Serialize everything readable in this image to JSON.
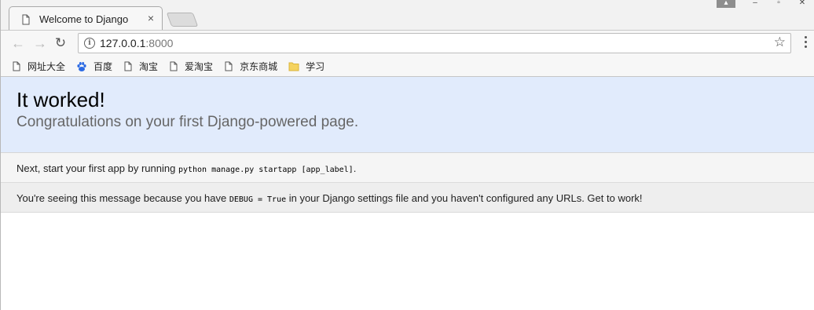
{
  "browser": {
    "tab_title": "Welcome to Django",
    "tab_close": "×",
    "url_host": "127.0.0.1",
    "url_port": ":8000",
    "icons": {
      "back": "arrow-left-icon",
      "forward": "arrow-right-icon",
      "reload": "reload-icon",
      "info": "info-icon",
      "star": "star-icon",
      "menu": "menu-icon"
    }
  },
  "bookmarks": [
    {
      "label": "网址大全",
      "icon": "page-icon"
    },
    {
      "label": "百度",
      "icon": "baidu-paw-icon"
    },
    {
      "label": "淘宝",
      "icon": "page-icon"
    },
    {
      "label": "爱淘宝",
      "icon": "page-icon"
    },
    {
      "label": "京东商城",
      "icon": "page-icon"
    },
    {
      "label": "学习",
      "icon": "folder-icon"
    }
  ],
  "page": {
    "title": "It worked!",
    "subtitle": "Congratulations on your first Django-powered page.",
    "instructions": {
      "prefix": "Next, start your first app by running ",
      "command": "python manage.py startapp [app_label]",
      "suffix": "."
    },
    "explanation": {
      "prefix": "You're seeing this message because you have ",
      "code": "DEBUG = True",
      "suffix": " in your Django settings file and you haven't configured any URLs. Get to work!"
    }
  },
  "colors": {
    "summary_bg": "#e1ebfc",
    "instructions_bg": "#f5f5f5",
    "explanation_bg": "#eeeeee",
    "baidu_blue": "#2d6be4",
    "folder_yellow": "#f5d35f"
  }
}
